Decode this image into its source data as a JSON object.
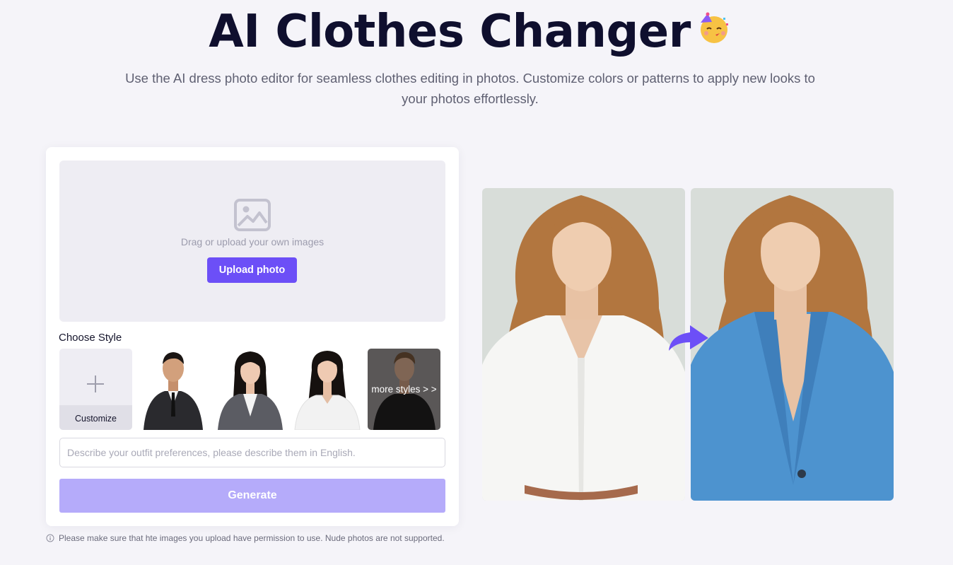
{
  "header": {
    "title": "AI Clothes Changer",
    "subtitle": "Use the AI dress photo editor for seamless clothes editing in photos. Customize colors or patterns to apply new looks to your photos effortlessly."
  },
  "uploader": {
    "drop_text": "Drag or upload your own images",
    "upload_label": "Upload photo"
  },
  "styles": {
    "label": "Choose Style",
    "customize_label": "Customize",
    "more_label": "more styles > >"
  },
  "prompt": {
    "placeholder": "Describe your outfit preferences, please describe them in English."
  },
  "generate_label": "Generate",
  "notice": "Please make sure that hte images you upload have permission to use. Nude photos are not supported.",
  "colors": {
    "accent": "#6c4ff7",
    "accent_disabled": "#b5abfa",
    "background": "#f5f4f9"
  }
}
